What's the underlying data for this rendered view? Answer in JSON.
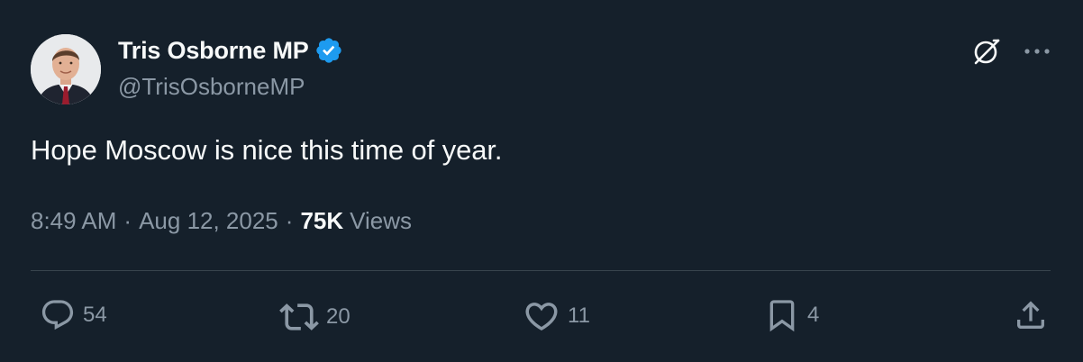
{
  "author": {
    "display_name": "Tris Osborne MP",
    "handle": "@TrisOsborneMP",
    "verified": true
  },
  "tweet": {
    "text": "Hope Moscow is nice this time of year.",
    "time": "8:49 AM",
    "separator": "·",
    "date": "Aug 12, 2025",
    "views_count": "75K",
    "views_label": "Views"
  },
  "actions": {
    "replies": "54",
    "reposts": "20",
    "likes": "11",
    "bookmarks": "4"
  },
  "icons": {
    "grok": "grok-icon",
    "more": "more-icon",
    "reply": "reply-icon",
    "repost": "repost-icon",
    "like": "heart-icon",
    "bookmark": "bookmark-icon",
    "share": "share-icon",
    "verified": "verified-badge-icon"
  },
  "colors": {
    "background": "#15202b",
    "text_primary": "#f7f9f9",
    "text_secondary": "#8b98a5",
    "divider": "#38444d",
    "verified_blue": "#1d9bf0"
  }
}
